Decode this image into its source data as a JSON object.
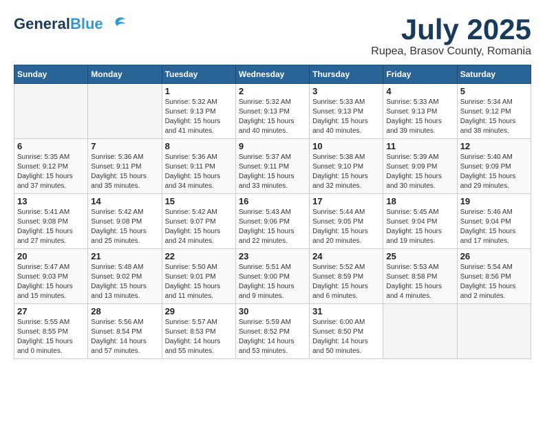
{
  "header": {
    "logo_general": "General",
    "logo_blue": "Blue",
    "month_year": "July 2025",
    "location": "Rupea, Brasov County, Romania"
  },
  "days_of_week": [
    "Sunday",
    "Monday",
    "Tuesday",
    "Wednesday",
    "Thursday",
    "Friday",
    "Saturday"
  ],
  "weeks": [
    [
      {
        "day": "",
        "info": ""
      },
      {
        "day": "",
        "info": ""
      },
      {
        "day": "1",
        "info": "Sunrise: 5:32 AM\nSunset: 9:13 PM\nDaylight: 15 hours\nand 41 minutes."
      },
      {
        "day": "2",
        "info": "Sunrise: 5:32 AM\nSunset: 9:13 PM\nDaylight: 15 hours\nand 40 minutes."
      },
      {
        "day": "3",
        "info": "Sunrise: 5:33 AM\nSunset: 9:13 PM\nDaylight: 15 hours\nand 40 minutes."
      },
      {
        "day": "4",
        "info": "Sunrise: 5:33 AM\nSunset: 9:13 PM\nDaylight: 15 hours\nand 39 minutes."
      },
      {
        "day": "5",
        "info": "Sunrise: 5:34 AM\nSunset: 9:12 PM\nDaylight: 15 hours\nand 38 minutes."
      }
    ],
    [
      {
        "day": "6",
        "info": "Sunrise: 5:35 AM\nSunset: 9:12 PM\nDaylight: 15 hours\nand 37 minutes."
      },
      {
        "day": "7",
        "info": "Sunrise: 5:36 AM\nSunset: 9:11 PM\nDaylight: 15 hours\nand 35 minutes."
      },
      {
        "day": "8",
        "info": "Sunrise: 5:36 AM\nSunset: 9:11 PM\nDaylight: 15 hours\nand 34 minutes."
      },
      {
        "day": "9",
        "info": "Sunrise: 5:37 AM\nSunset: 9:11 PM\nDaylight: 15 hours\nand 33 minutes."
      },
      {
        "day": "10",
        "info": "Sunrise: 5:38 AM\nSunset: 9:10 PM\nDaylight: 15 hours\nand 32 minutes."
      },
      {
        "day": "11",
        "info": "Sunrise: 5:39 AM\nSunset: 9:09 PM\nDaylight: 15 hours\nand 30 minutes."
      },
      {
        "day": "12",
        "info": "Sunrise: 5:40 AM\nSunset: 9:09 PM\nDaylight: 15 hours\nand 29 minutes."
      }
    ],
    [
      {
        "day": "13",
        "info": "Sunrise: 5:41 AM\nSunset: 9:08 PM\nDaylight: 15 hours\nand 27 minutes."
      },
      {
        "day": "14",
        "info": "Sunrise: 5:42 AM\nSunset: 9:08 PM\nDaylight: 15 hours\nand 25 minutes."
      },
      {
        "day": "15",
        "info": "Sunrise: 5:42 AM\nSunset: 9:07 PM\nDaylight: 15 hours\nand 24 minutes."
      },
      {
        "day": "16",
        "info": "Sunrise: 5:43 AM\nSunset: 9:06 PM\nDaylight: 15 hours\nand 22 minutes."
      },
      {
        "day": "17",
        "info": "Sunrise: 5:44 AM\nSunset: 9:05 PM\nDaylight: 15 hours\nand 20 minutes."
      },
      {
        "day": "18",
        "info": "Sunrise: 5:45 AM\nSunset: 9:04 PM\nDaylight: 15 hours\nand 19 minutes."
      },
      {
        "day": "19",
        "info": "Sunrise: 5:46 AM\nSunset: 9:04 PM\nDaylight: 15 hours\nand 17 minutes."
      }
    ],
    [
      {
        "day": "20",
        "info": "Sunrise: 5:47 AM\nSunset: 9:03 PM\nDaylight: 15 hours\nand 15 minutes."
      },
      {
        "day": "21",
        "info": "Sunrise: 5:48 AM\nSunset: 9:02 PM\nDaylight: 15 hours\nand 13 minutes."
      },
      {
        "day": "22",
        "info": "Sunrise: 5:50 AM\nSunset: 9:01 PM\nDaylight: 15 hours\nand 11 minutes."
      },
      {
        "day": "23",
        "info": "Sunrise: 5:51 AM\nSunset: 9:00 PM\nDaylight: 15 hours\nand 9 minutes."
      },
      {
        "day": "24",
        "info": "Sunrise: 5:52 AM\nSunset: 8:59 PM\nDaylight: 15 hours\nand 6 minutes."
      },
      {
        "day": "25",
        "info": "Sunrise: 5:53 AM\nSunset: 8:58 PM\nDaylight: 15 hours\nand 4 minutes."
      },
      {
        "day": "26",
        "info": "Sunrise: 5:54 AM\nSunset: 8:56 PM\nDaylight: 15 hours\nand 2 minutes."
      }
    ],
    [
      {
        "day": "27",
        "info": "Sunrise: 5:55 AM\nSunset: 8:55 PM\nDaylight: 15 hours\nand 0 minutes."
      },
      {
        "day": "28",
        "info": "Sunrise: 5:56 AM\nSunset: 8:54 PM\nDaylight: 14 hours\nand 57 minutes."
      },
      {
        "day": "29",
        "info": "Sunrise: 5:57 AM\nSunset: 8:53 PM\nDaylight: 14 hours\nand 55 minutes."
      },
      {
        "day": "30",
        "info": "Sunrise: 5:59 AM\nSunset: 8:52 PM\nDaylight: 14 hours\nand 53 minutes."
      },
      {
        "day": "31",
        "info": "Sunrise: 6:00 AM\nSunset: 8:50 PM\nDaylight: 14 hours\nand 50 minutes."
      },
      {
        "day": "",
        "info": ""
      },
      {
        "day": "",
        "info": ""
      }
    ]
  ]
}
